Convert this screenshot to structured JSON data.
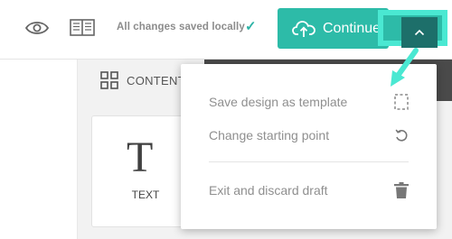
{
  "topbar": {
    "status_text": "All changes saved locally",
    "check_glyph": "✓",
    "continue_label": "Continue",
    "icons": [
      "eye-icon",
      "book-icon",
      "cloud-upload-icon",
      "chevron-up-icon"
    ]
  },
  "content_tab": {
    "label": "CONTENT"
  },
  "text_block": {
    "glyph": "T",
    "label": "TEXT"
  },
  "menu": {
    "items": [
      {
        "label": "Save design as template",
        "icon": "dashed-square-icon"
      },
      {
        "label": "Change starting point",
        "icon": "undo-icon"
      },
      {
        "label": "Exit and discard draft",
        "icon": "trash-icon"
      }
    ]
  },
  "colors": {
    "accent": "#2dbba8",
    "highlight": "#4ae8d2",
    "caret_bg": "#1d6f6a",
    "menu_text": "#8f8f8f"
  }
}
